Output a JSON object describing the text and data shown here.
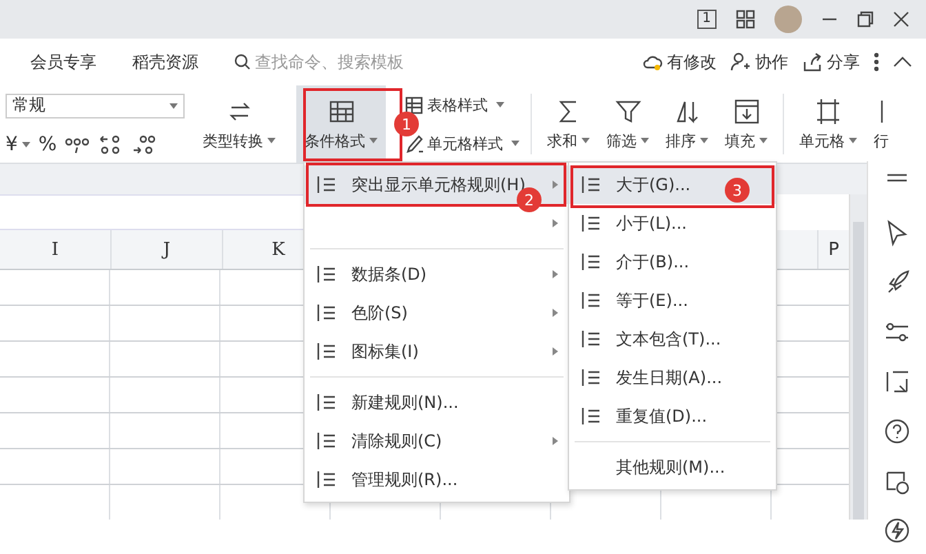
{
  "title_bar": {
    "badge": "1"
  },
  "top_bar": {
    "tabs": [
      {
        "label": "会员专享"
      },
      {
        "label": "稻壳资源"
      }
    ],
    "search": {
      "placeholder": "查找命令、搜索模板"
    },
    "actions": [
      {
        "label": "有修改"
      },
      {
        "label": "协作"
      },
      {
        "label": "分享"
      }
    ]
  },
  "ribbon": {
    "number_format": {
      "value": "常规"
    },
    "symbols": [
      {
        "label": "¥",
        "dropdown": true
      },
      {
        "label": "%",
        "dropdown": false
      }
    ],
    "tools": [
      {
        "kind": "large",
        "label": "类型转换",
        "dropdown": true,
        "selected": false
      },
      {
        "kind": "large",
        "label": "条件格式",
        "dropdown": true,
        "selected": true
      },
      {
        "kind": "small",
        "label": "表格样式",
        "dropdown": true
      },
      {
        "kind": "small",
        "label": "单元格样式",
        "dropdown": true
      },
      {
        "kind": "large",
        "label": "求和",
        "dropdown": true,
        "selected": false
      },
      {
        "kind": "large",
        "label": "筛选",
        "dropdown": true,
        "selected": false
      },
      {
        "kind": "large",
        "label": "排序",
        "dropdown": true,
        "selected": false
      },
      {
        "kind": "large",
        "label": "填充",
        "dropdown": true,
        "selected": false
      },
      {
        "kind": "large",
        "label": "单元格",
        "dropdown": true,
        "selected": false
      },
      {
        "kind": "large",
        "label": "行",
        "dropdown": false,
        "selected": false
      }
    ]
  },
  "sheet": {
    "columns": [
      "I",
      "J",
      "K",
      "P"
    ]
  },
  "menu": {
    "items": [
      {
        "kind": "item",
        "label": "突出显示单元格规则(H)",
        "submenu": true,
        "selected": true
      },
      {
        "kind": "item",
        "submenu": true,
        "selected": false
      },
      {
        "kind": "separator"
      },
      {
        "kind": "item",
        "label": "数据条(D)",
        "submenu": true,
        "selected": false
      },
      {
        "kind": "item",
        "label": "色阶(S)",
        "submenu": true,
        "selected": false
      },
      {
        "kind": "item",
        "label": "图标集(I)",
        "submenu": true,
        "selected": false
      },
      {
        "kind": "separator"
      },
      {
        "kind": "item",
        "label": "新建规则(N)...",
        "submenu": false,
        "selected": false
      },
      {
        "kind": "item",
        "label": "清除规则(C)",
        "submenu": true,
        "selected": false
      },
      {
        "kind": "item",
        "label": "管理规则(R)...",
        "submenu": false,
        "selected": false
      }
    ]
  },
  "submenu": {
    "items": [
      {
        "kind": "item",
        "label": "大于(G)...",
        "selected": true
      },
      {
        "kind": "item",
        "label": "小于(L)...",
        "selected": false
      },
      {
        "kind": "item",
        "label": "介于(B)...",
        "selected": false
      },
      {
        "kind": "item",
        "label": "等于(E)...",
        "selected": false
      },
      {
        "kind": "item",
        "label": "文本包含(T)...",
        "selected": false
      },
      {
        "kind": "item",
        "label": "发生日期(A)...",
        "selected": false
      },
      {
        "kind": "item",
        "label": "重复值(D)...",
        "selected": false
      },
      {
        "kind": "separator"
      },
      {
        "kind": "plain",
        "label": "其他规则(M)...",
        "selected": false
      }
    ]
  },
  "callouts": [
    {
      "label": "1"
    },
    {
      "label": "2"
    },
    {
      "label": "3"
    }
  ]
}
